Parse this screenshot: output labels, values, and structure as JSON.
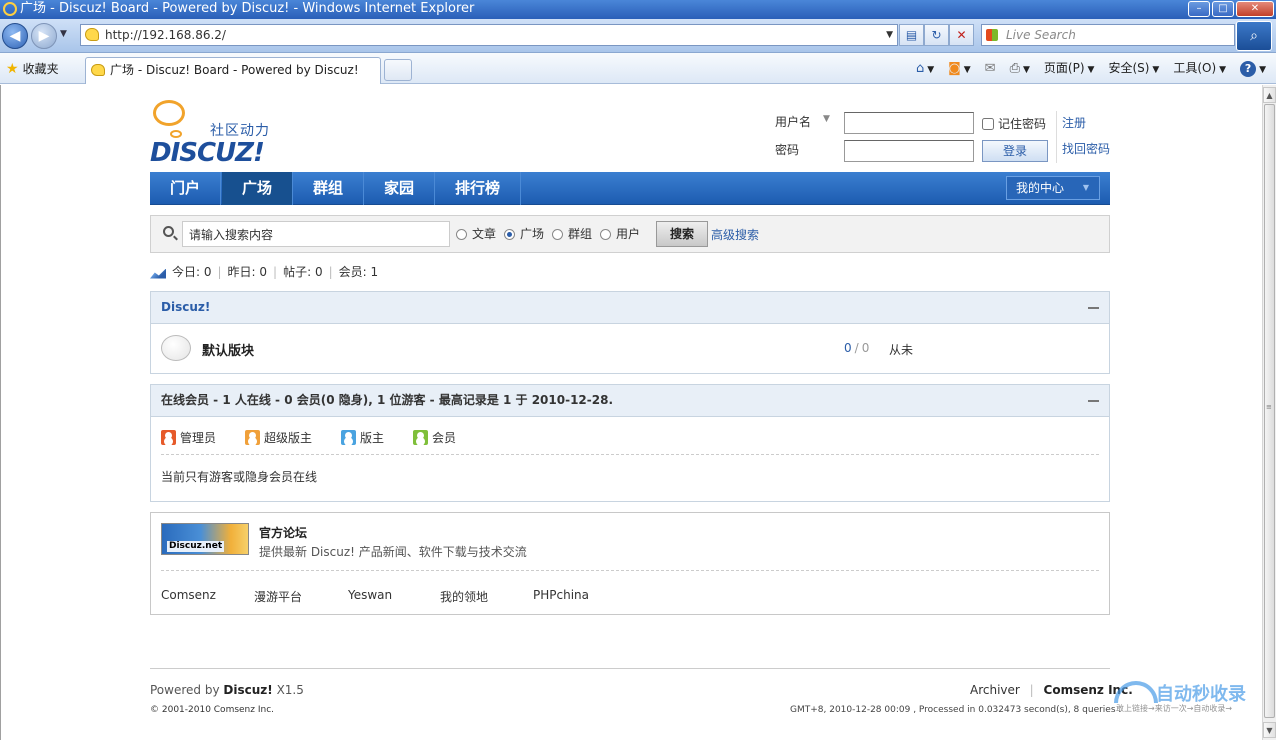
{
  "window": {
    "title": "广场 - Discuz! Board - Powered by Discuz! - Windows Internet Explorer",
    "controls": [
      "–",
      "□",
      "✕"
    ]
  },
  "browser": {
    "url": "http://192.168.86.2/",
    "search_placeholder": "Live Search",
    "favorites_label": "收藏夹",
    "tab_title": "广场 - Discuz! Board - Powered by Discuz!",
    "menu": {
      "page": "页面(P)",
      "safety": "安全(S)",
      "tools": "工具(O)"
    }
  },
  "header": {
    "logo_slogan": "社区动力",
    "logo_text": "DISCUZ!",
    "login": {
      "username_label": "用户名",
      "password_label": "密码",
      "remember_label": "记住密码",
      "login_button": "登录",
      "register_link": "注册",
      "forgot_link": "找回密码"
    }
  },
  "nav": {
    "items": [
      {
        "label": "门户",
        "active": false
      },
      {
        "label": "广场",
        "active": true
      },
      {
        "label": "群组",
        "active": false
      },
      {
        "label": "家园",
        "active": false
      },
      {
        "label": "排行榜",
        "active": false
      }
    ],
    "my_center": "我的中心"
  },
  "search": {
    "placeholder": "请输入搜索内容",
    "options": [
      "文章",
      "广场",
      "群组",
      "用户"
    ],
    "selected": "广场",
    "button": "搜索",
    "advanced": "高级搜索"
  },
  "stats": {
    "today": "今日: 0",
    "yesterday": "昨日: 0",
    "posts": "帖子: 0",
    "members": "会员: 1"
  },
  "category": {
    "title": "Discuz!",
    "forums": [
      {
        "name": "默认版块",
        "threads": "0",
        "posts": "0",
        "last_post": "从未"
      }
    ]
  },
  "online": {
    "title": "在线会员 - 1 人在线 - 0 会员(0 隐身), 1 位游客 - 最高记录是 1 于 2010-12-28.",
    "legend": [
      {
        "label": "管理员",
        "color": "#e65a2a"
      },
      {
        "label": "超级版主",
        "color": "#f0a03a"
      },
      {
        "label": "版主",
        "color": "#4aa3e0"
      },
      {
        "label": "会员",
        "color": "#7fbf3a"
      }
    ],
    "message": "当前只有游客或隐身会员在线"
  },
  "links": {
    "banner_text": "Discuz.net",
    "title": "官方论坛",
    "description": "提供最新 Discuz! 产品新闻、软件下载与技术交流",
    "items": [
      "Comsenz",
      "漫游平台",
      "Yeswan",
      "我的领地",
      "PHPchina"
    ]
  },
  "footer": {
    "powered_prefix": "Powered by",
    "powered_name": "Discuz!",
    "version": "X1.5",
    "copyright": "© 2001-2010 Comsenz Inc.",
    "archiver": "Archiver",
    "company": "Comsenz Inc.",
    "processed": "GMT+8, 2010-12-28 00:09 , Processed in 0.032473 second(s), 8 queries ."
  },
  "watermark": {
    "text": "自动秒收录",
    "subtext": "敢上链接→来访一次→自动收录→"
  }
}
